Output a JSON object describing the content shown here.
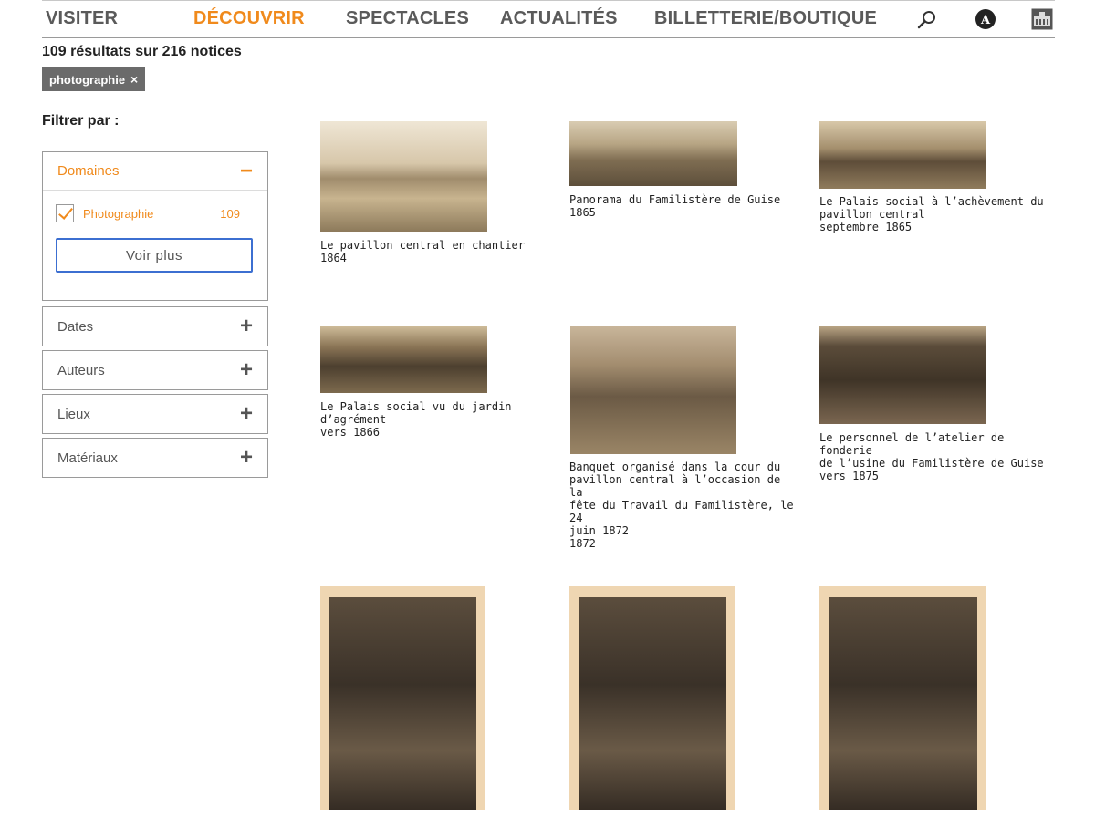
{
  "nav": {
    "items": [
      "VISITER",
      "DÉCOUVRIR",
      "SPECTACLES",
      "ACTUALITÉS",
      "BILLETTERIE/BOUTIQUE"
    ],
    "active_index": 1,
    "icons": [
      "search-icon",
      "accessibility-icon",
      "museum-icon"
    ],
    "accessibility_letter": "A"
  },
  "results": {
    "count_text": "109 résultats sur 216 notices",
    "active_filter": "photographie",
    "remove_symbol": "×"
  },
  "sidebar": {
    "title": "Filtrer par :",
    "facets": [
      {
        "label": "Domaines",
        "toggle": "−",
        "open": true,
        "options": [
          {
            "label": "Photographie",
            "count": "109",
            "checked": true
          }
        ],
        "more_label": "Voir plus"
      },
      {
        "label": "Dates",
        "toggle": "+"
      },
      {
        "label": "Auteurs",
        "toggle": "+"
      },
      {
        "label": "Lieux",
        "toggle": "+"
      },
      {
        "label": "Matériaux",
        "toggle": "+"
      }
    ]
  },
  "items": [
    {
      "caption": "Le pavillon central en chantier\n1864"
    },
    {
      "caption": "Panorama du Familistère de Guise\n1865"
    },
    {
      "caption": "Le Palais social à l’achèvement du\npavillon central\nseptembre 1865"
    },
    {
      "caption": "Le Palais social vu du jardin\nd’agrément\nvers 1866"
    },
    {
      "caption": "Banquet organisé dans la cour du\npavillon central à l’occasion de la\nfête du Travail du Familistère, le 24\njuin 1872\n1872"
    },
    {
      "caption": "Le personnel de l’atelier de fonderie\nde l’usine du Familistère de Guise\nvers 1875"
    },
    {
      "caption": ""
    },
    {
      "caption": ""
    },
    {
      "caption": ""
    }
  ],
  "colors": {
    "accent": "#f08a1c",
    "chip": "#6b6b6b",
    "focus_border": "#3c6fd1",
    "nav_text": "#5a5a5a"
  }
}
